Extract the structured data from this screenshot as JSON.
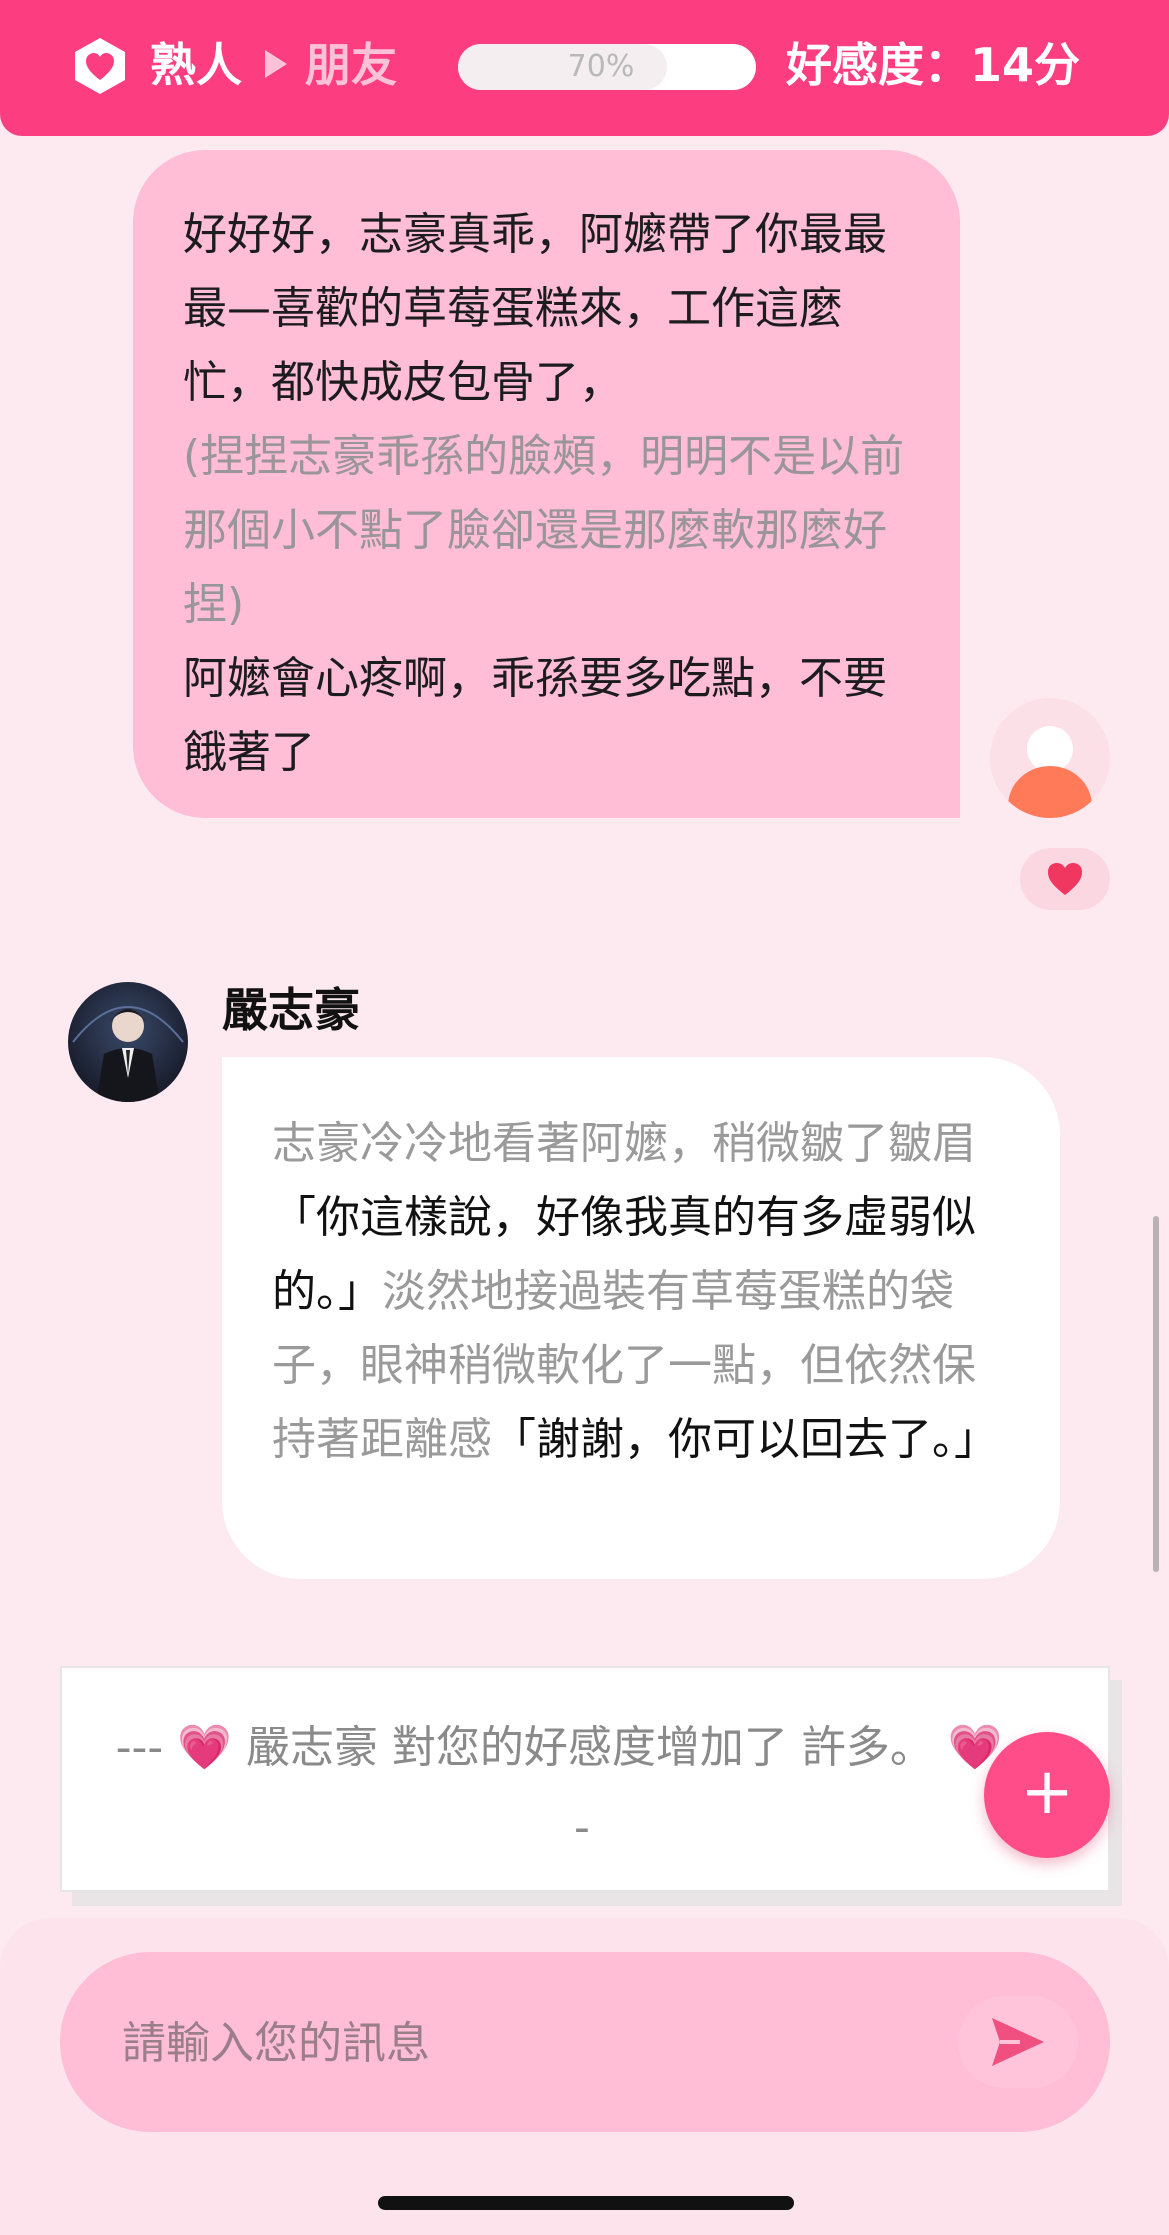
{
  "header": {
    "relation_from": "熟人",
    "relation_to": "朋友",
    "progress_percent": 70,
    "progress_label": "70%",
    "affection_label": "好感度：14分",
    "colors": {
      "bar": "#fc3d80",
      "next_relation": "#fbc2d6"
    },
    "icons": {
      "badge": "heart-hexagon-icon",
      "arrow": "triangle-right-icon"
    }
  },
  "messages": {
    "user": {
      "line1": "好好好，志豪真乖，阿嬤帶了你最最最—喜歡的草莓蛋糕來，工作這麼忙，都快成皮包骨了，",
      "action": "(捏捏志豪乖孫的臉頰，明明不是以前那個小不點了臉卻還是那麼軟那麼好捏)",
      "line2": "阿嬤會心疼啊，乖孫要多吃點，不要餓著了",
      "avatar_icon": "user-avatar-icon",
      "like_icon": "heart-icon"
    },
    "bot": {
      "name": "嚴志豪",
      "narration1": "志豪冷冷地看著阿嬤，稍微皺了皺眉",
      "speech1": "「你這樣說，好像我真的有多虛弱似的。」",
      "narration2": "淡然地接過裝有草莓蛋糕的袋子，眼神稍微軟化了一點，但依然保持著距離感",
      "speech2": "「謝謝，你可以回去了。」"
    }
  },
  "notification": {
    "text": "--- 💗 嚴志豪 對您的好感度增加了 許多。 💗 ---"
  },
  "fab": {
    "label": "+"
  },
  "composer": {
    "placeholder": "請輸入您的訊息",
    "value": "",
    "send_icon": "send-icon"
  }
}
